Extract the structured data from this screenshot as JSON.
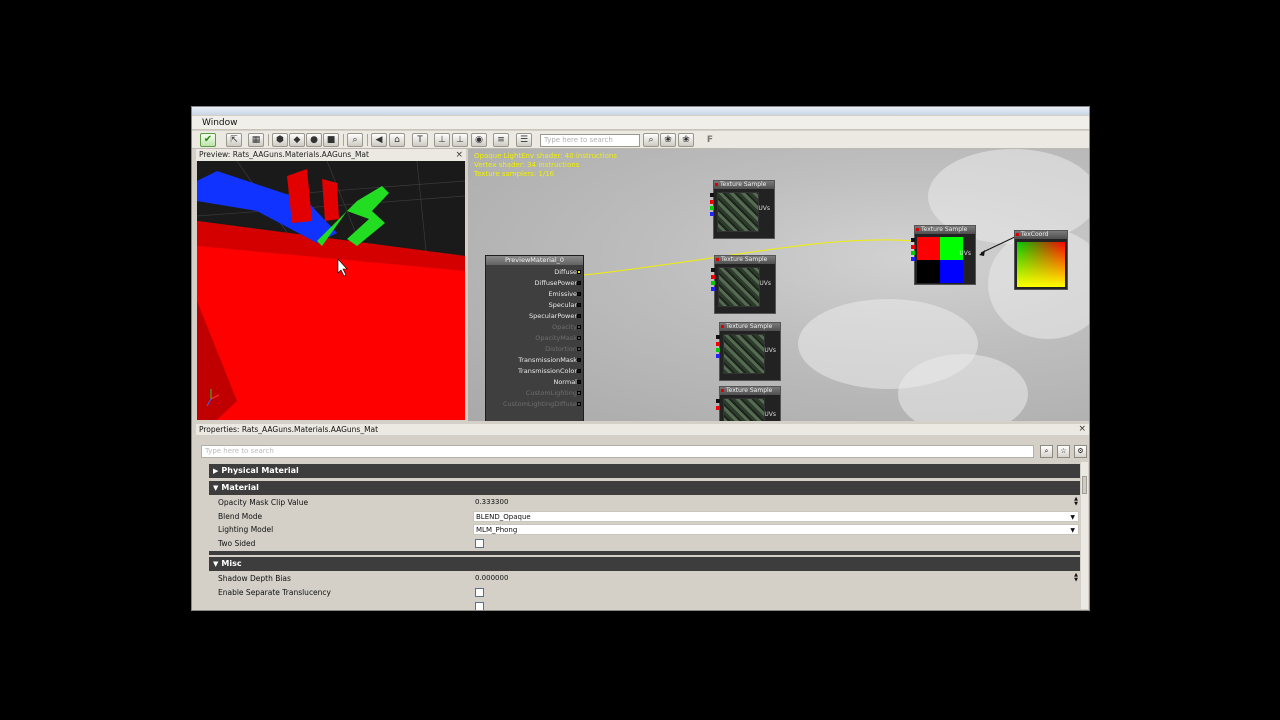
{
  "menu": {
    "window": "Window"
  },
  "toolbar": {
    "search_placeholder": "Type here to search",
    "f_label": "F"
  },
  "preview": {
    "title": "Preview: Rats_AAGuns.Materials.AAGuns_Mat",
    "close": "×"
  },
  "graph": {
    "stats": [
      "Opaque LightEnv shader: 40 instructions",
      "Vertex shader: 34 instructions",
      "Texture samplers: 1/16"
    ],
    "material_node": {
      "title": "PreviewMaterial_0",
      "inputs": [
        {
          "label": "Diffuse",
          "enabled": true
        },
        {
          "label": "DiffusePower",
          "enabled": true
        },
        {
          "label": "Emissive",
          "enabled": true
        },
        {
          "label": "Specular",
          "enabled": true
        },
        {
          "label": "SpecularPower",
          "enabled": true
        },
        {
          "label": "Opacity",
          "enabled": false
        },
        {
          "label": "OpacityMask",
          "enabled": false
        },
        {
          "label": "Distortion",
          "enabled": false
        },
        {
          "label": "TransmissionMask",
          "enabled": true
        },
        {
          "label": "TransmissionColor",
          "enabled": true
        },
        {
          "label": "Normal",
          "enabled": true
        },
        {
          "label": "CustomLighting",
          "enabled": false
        },
        {
          "label": "CustomLightingDiffuse",
          "enabled": false
        }
      ]
    },
    "texture_nodes": [
      {
        "title": "Texture Sample",
        "pin": "UVs"
      },
      {
        "title": "Texture Sample",
        "pin": "UVs"
      },
      {
        "title": "Texture Sample",
        "pin": "UVs"
      },
      {
        "title": "Texture Sample",
        "pin": "UVs"
      },
      {
        "title": "Texture Sample",
        "pin": "UVs"
      }
    ],
    "texcoord_node": {
      "title": "TexCoord"
    }
  },
  "properties": {
    "title": "Properties: Rats_AAGuns.Materials.AAGuns_Mat",
    "close": "×",
    "search_placeholder": "Type here to search",
    "categories": {
      "physical": "Physical Material",
      "material": "Material",
      "misc": "Misc"
    },
    "rows": {
      "opacity_mask_clip": {
        "name": "Opacity Mask Clip Value",
        "value": "0.333300"
      },
      "blend_mode": {
        "name": "Blend Mode",
        "value": "BLEND_Opaque"
      },
      "lighting_model": {
        "name": "Lighting Model",
        "value": "MLM_Phong"
      },
      "two_sided": {
        "name": "Two Sided"
      },
      "shadow_depth_bias": {
        "name": "Shadow Depth Bias",
        "value": "0.000000"
      },
      "separate_translucency": {
        "name": "Enable Separate Translucency"
      }
    }
  },
  "colors": {
    "graph_bg": "#bebebe",
    "category_bg": "#3d3d3d",
    "wire": "#f0f000",
    "model_red": "#ff0000",
    "model_green": "#22dd22",
    "model_blue": "#1133ff"
  }
}
